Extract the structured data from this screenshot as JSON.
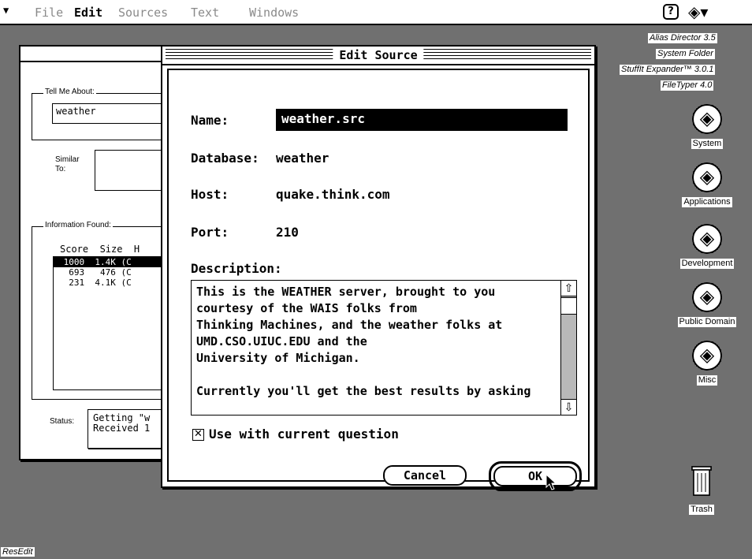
{
  "menubar": {
    "apple": "",
    "items": [
      "File",
      "Edit",
      "Sources",
      "Text",
      "Windows"
    ],
    "help_icon": "?",
    "app_icon": "app-switcher-icon"
  },
  "background_window": {
    "tell_me_about_label": "Tell Me About:",
    "tell_me_about_value": "weather",
    "similar_to_label": "Similar To:",
    "information_found_label": "Information Found:",
    "columns": "Score  Size  H",
    "results": [
      {
        "text": " 1000  1.4K (C",
        "selected": true
      },
      {
        "text": "  693   476 (C",
        "selected": false
      },
      {
        "text": "  231  4.1K (C",
        "selected": false
      }
    ],
    "status_label": "Status:",
    "status_text": "Getting \"w\nReceived 1"
  },
  "dialog": {
    "title": "Edit Source",
    "name_label": "Name:",
    "name_value": "weather.src",
    "database_label": "Database:",
    "database_value": "weather",
    "host_label": "Host:",
    "host_value": "quake.think.com",
    "port_label": "Port:",
    "port_value": "210",
    "description_label": "Description:",
    "description_text": "This is the WEATHER server, brought to you\ncourtesy of the WAIS folks from\nThinking Machines, and the weather folks at\nUMD.CSO.UIUC.EDU and the\nUniversity of Michigan.\n\nCurrently you'll get the best results by asking",
    "use_checkbox_label": "Use with current question",
    "use_checked": true,
    "cancel_label": "Cancel",
    "ok_label": "OK"
  },
  "desktop": {
    "top_labels": [
      "Alias Director 3.5",
      "System Folder",
      "StuffIt Expander™ 3.0.1",
      "FileTyper 4.0"
    ],
    "folders": [
      "System",
      "Applications",
      "Development",
      "Public Domain",
      "Misc"
    ],
    "trash_label": "Trash",
    "bottom_left_label": "ResEdit"
  }
}
